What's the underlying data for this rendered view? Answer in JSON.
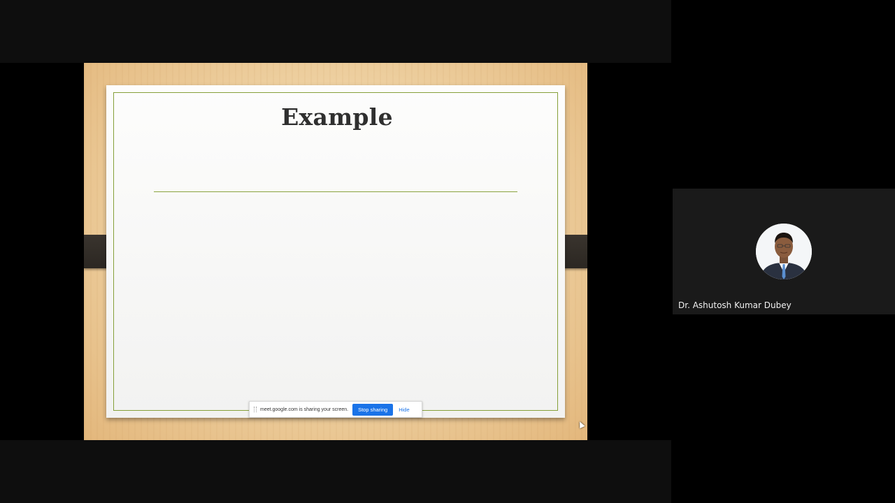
{
  "slide": {
    "title": "Example"
  },
  "screen_share_bar": {
    "message": "meet.google.com is sharing your screen.",
    "stop_label": "Stop sharing",
    "hide_label": "Hide"
  },
  "participant": {
    "name": "Dr. Ashutosh Kumar Dubey"
  },
  "colors": {
    "background": "#000000",
    "tile": "#1a1a1a",
    "accent_blue": "#1a73e8",
    "slide_frame_green": "#86a03a"
  },
  "icons": {
    "avatar": "person-avatar",
    "cursor": "mouse-cursor-icon",
    "drag": "drag-handle-icon"
  }
}
